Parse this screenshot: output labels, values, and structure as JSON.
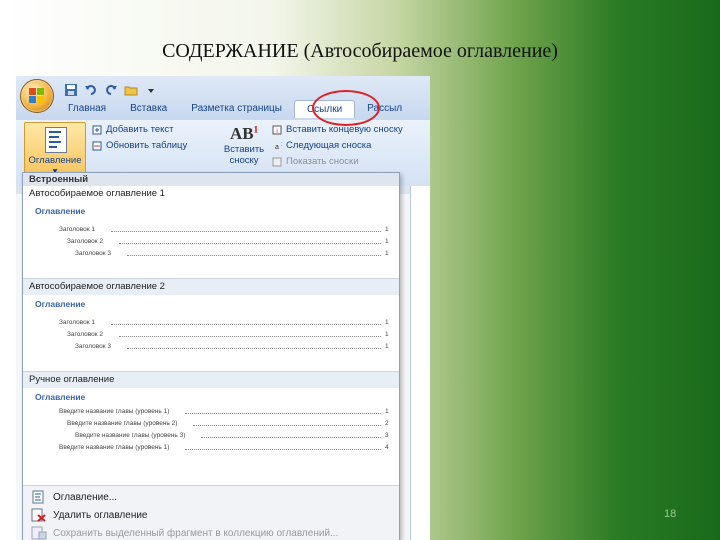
{
  "slide": {
    "title": "СОДЕРЖАНИЕ (Автособираемое оглавление)",
    "page_number": "18"
  },
  "ribbon": {
    "tabs": [
      {
        "label": "Главная"
      },
      {
        "label": "Вставка"
      },
      {
        "label": "Разметка страницы"
      },
      {
        "label": "Ссылки"
      },
      {
        "label": "Рассыл"
      }
    ],
    "active_tab": "Ссылки",
    "toc_button": {
      "label": "Оглавление",
      "arrow": "▾"
    },
    "add_text": "Добавить текст",
    "update_table": "Обновить таблицу",
    "insert_footnote": {
      "line1": "Вставить",
      "line2": "сноску"
    },
    "insert_endnote": "Вставить концевую сноску",
    "next_footnote": "Следующая сноска",
    "show_notes": "Показать сноски"
  },
  "dropdown": {
    "section_builtin": "Встроенный",
    "galleries": [
      {
        "title": "Автособираемое оглавление 1",
        "heading": "Оглавление",
        "entries": [
          {
            "text": "Заголовок 1",
            "page": "1",
            "level": 1
          },
          {
            "text": "Заголовок 2",
            "page": "1",
            "level": 2
          },
          {
            "text": "Заголовок 3",
            "page": "1",
            "level": 3
          }
        ]
      },
      {
        "title": "Автособираемое оглавление 2",
        "heading": "Оглавление",
        "entries": [
          {
            "text": "Заголовок 1",
            "page": "1",
            "level": 1
          },
          {
            "text": "Заголовок 2",
            "page": "1",
            "level": 2
          },
          {
            "text": "Заголовок 3",
            "page": "1",
            "level": 3
          }
        ]
      },
      {
        "title": "Ручное оглавление",
        "heading": "Оглавление",
        "entries": [
          {
            "text": "Введите название главы (уровень 1)",
            "page": "1",
            "level": 1
          },
          {
            "text": "Введите название главы (уровень 2)",
            "page": "2",
            "level": 2
          },
          {
            "text": "Введите название главы (уровень 3)",
            "page": "3",
            "level": 3
          },
          {
            "text": "Введите название главы (уровень 1)",
            "page": "4",
            "level": 1
          }
        ]
      }
    ],
    "menu": [
      {
        "label": "Оглавление...",
        "enabled": true,
        "icon": "toc-dialog-icon"
      },
      {
        "label": "Удалить оглавление",
        "enabled": true,
        "icon": "remove-toc-icon"
      },
      {
        "label": "Сохранить выделенный фрагмент в коллекцию оглавлений...",
        "enabled": false,
        "icon": "save-selection-icon"
      }
    ]
  },
  "colors": {
    "accent_circle": "#e02020",
    "toc_heading": "#3a66a8",
    "ribbon_text": "#15428b"
  }
}
